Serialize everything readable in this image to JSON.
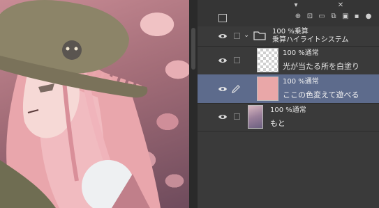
{
  "layers": {
    "folder": {
      "mode": "100 %乗算",
      "name": "乗算ハイライトシステム"
    },
    "items": [
      {
        "mode": "100 %通常",
        "name": "光が当たる所を白塗り",
        "thumb": "transparent"
      },
      {
        "mode": "100 %通常",
        "name": "ここの色変えて遊べる",
        "thumb": "#e9a7a8",
        "selected": true
      },
      {
        "mode": "100 %通常",
        "name": "もと",
        "thumb": "illustration"
      }
    ]
  },
  "colors": {
    "panel_bg": "#3a3a3a",
    "selected_row": "#5d6b8c",
    "swatch": "#e9a7a8"
  }
}
